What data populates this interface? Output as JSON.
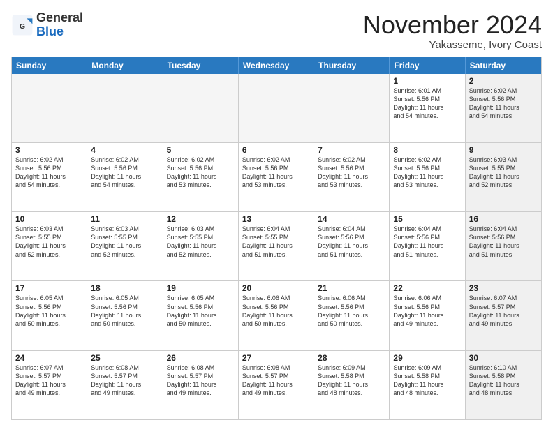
{
  "logo": {
    "general": "General",
    "blue": "Blue"
  },
  "header": {
    "month": "November 2024",
    "location": "Yakasseme, Ivory Coast"
  },
  "weekdays": [
    "Sunday",
    "Monday",
    "Tuesday",
    "Wednesday",
    "Thursday",
    "Friday",
    "Saturday"
  ],
  "rows": [
    [
      {
        "day": "",
        "info": "",
        "empty": true
      },
      {
        "day": "",
        "info": "",
        "empty": true
      },
      {
        "day": "",
        "info": "",
        "empty": true
      },
      {
        "day": "",
        "info": "",
        "empty": true
      },
      {
        "day": "",
        "info": "",
        "empty": true
      },
      {
        "day": "1",
        "info": "Sunrise: 6:01 AM\nSunset: 5:56 PM\nDaylight: 11 hours\nand 54 minutes."
      },
      {
        "day": "2",
        "info": "Sunrise: 6:02 AM\nSunset: 5:56 PM\nDaylight: 11 hours\nand 54 minutes.",
        "shaded": true
      }
    ],
    [
      {
        "day": "3",
        "info": "Sunrise: 6:02 AM\nSunset: 5:56 PM\nDaylight: 11 hours\nand 54 minutes."
      },
      {
        "day": "4",
        "info": "Sunrise: 6:02 AM\nSunset: 5:56 PM\nDaylight: 11 hours\nand 54 minutes."
      },
      {
        "day": "5",
        "info": "Sunrise: 6:02 AM\nSunset: 5:56 PM\nDaylight: 11 hours\nand 53 minutes."
      },
      {
        "day": "6",
        "info": "Sunrise: 6:02 AM\nSunset: 5:56 PM\nDaylight: 11 hours\nand 53 minutes."
      },
      {
        "day": "7",
        "info": "Sunrise: 6:02 AM\nSunset: 5:56 PM\nDaylight: 11 hours\nand 53 minutes."
      },
      {
        "day": "8",
        "info": "Sunrise: 6:02 AM\nSunset: 5:56 PM\nDaylight: 11 hours\nand 53 minutes."
      },
      {
        "day": "9",
        "info": "Sunrise: 6:03 AM\nSunset: 5:55 PM\nDaylight: 11 hours\nand 52 minutes.",
        "shaded": true
      }
    ],
    [
      {
        "day": "10",
        "info": "Sunrise: 6:03 AM\nSunset: 5:55 PM\nDaylight: 11 hours\nand 52 minutes."
      },
      {
        "day": "11",
        "info": "Sunrise: 6:03 AM\nSunset: 5:55 PM\nDaylight: 11 hours\nand 52 minutes."
      },
      {
        "day": "12",
        "info": "Sunrise: 6:03 AM\nSunset: 5:55 PM\nDaylight: 11 hours\nand 52 minutes."
      },
      {
        "day": "13",
        "info": "Sunrise: 6:04 AM\nSunset: 5:55 PM\nDaylight: 11 hours\nand 51 minutes."
      },
      {
        "day": "14",
        "info": "Sunrise: 6:04 AM\nSunset: 5:56 PM\nDaylight: 11 hours\nand 51 minutes."
      },
      {
        "day": "15",
        "info": "Sunrise: 6:04 AM\nSunset: 5:56 PM\nDaylight: 11 hours\nand 51 minutes."
      },
      {
        "day": "16",
        "info": "Sunrise: 6:04 AM\nSunset: 5:56 PM\nDaylight: 11 hours\nand 51 minutes.",
        "shaded": true
      }
    ],
    [
      {
        "day": "17",
        "info": "Sunrise: 6:05 AM\nSunset: 5:56 PM\nDaylight: 11 hours\nand 50 minutes."
      },
      {
        "day": "18",
        "info": "Sunrise: 6:05 AM\nSunset: 5:56 PM\nDaylight: 11 hours\nand 50 minutes."
      },
      {
        "day": "19",
        "info": "Sunrise: 6:05 AM\nSunset: 5:56 PM\nDaylight: 11 hours\nand 50 minutes."
      },
      {
        "day": "20",
        "info": "Sunrise: 6:06 AM\nSunset: 5:56 PM\nDaylight: 11 hours\nand 50 minutes."
      },
      {
        "day": "21",
        "info": "Sunrise: 6:06 AM\nSunset: 5:56 PM\nDaylight: 11 hours\nand 50 minutes."
      },
      {
        "day": "22",
        "info": "Sunrise: 6:06 AM\nSunset: 5:56 PM\nDaylight: 11 hours\nand 49 minutes."
      },
      {
        "day": "23",
        "info": "Sunrise: 6:07 AM\nSunset: 5:57 PM\nDaylight: 11 hours\nand 49 minutes.",
        "shaded": true
      }
    ],
    [
      {
        "day": "24",
        "info": "Sunrise: 6:07 AM\nSunset: 5:57 PM\nDaylight: 11 hours\nand 49 minutes."
      },
      {
        "day": "25",
        "info": "Sunrise: 6:08 AM\nSunset: 5:57 PM\nDaylight: 11 hours\nand 49 minutes."
      },
      {
        "day": "26",
        "info": "Sunrise: 6:08 AM\nSunset: 5:57 PM\nDaylight: 11 hours\nand 49 minutes."
      },
      {
        "day": "27",
        "info": "Sunrise: 6:08 AM\nSunset: 5:57 PM\nDaylight: 11 hours\nand 49 minutes."
      },
      {
        "day": "28",
        "info": "Sunrise: 6:09 AM\nSunset: 5:58 PM\nDaylight: 11 hours\nand 48 minutes."
      },
      {
        "day": "29",
        "info": "Sunrise: 6:09 AM\nSunset: 5:58 PM\nDaylight: 11 hours\nand 48 minutes."
      },
      {
        "day": "30",
        "info": "Sunrise: 6:10 AM\nSunset: 5:58 PM\nDaylight: 11 hours\nand 48 minutes.",
        "shaded": true
      }
    ]
  ]
}
